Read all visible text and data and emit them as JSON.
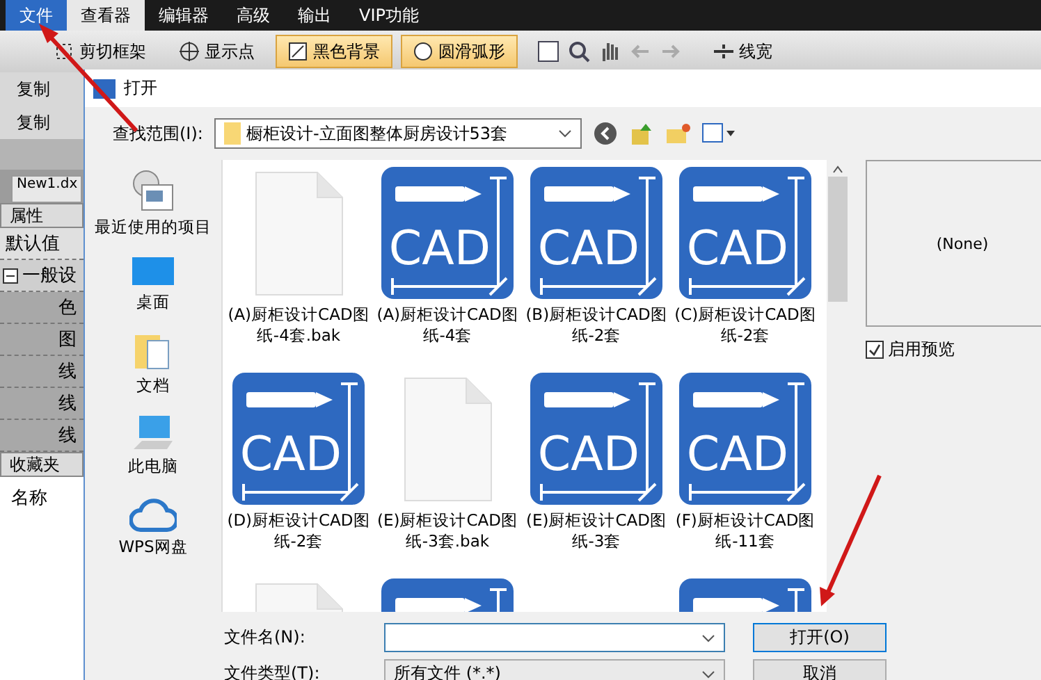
{
  "menu_tabs": [
    {
      "label": "文件",
      "kind": "file",
      "selected": false
    },
    {
      "label": "查看器",
      "kind": "tab",
      "selected": true
    },
    {
      "label": "编辑器",
      "kind": "tab",
      "selected": false
    },
    {
      "label": "高级",
      "kind": "tab",
      "selected": false
    },
    {
      "label": "输出",
      "kind": "tab",
      "selected": false
    },
    {
      "label": "VIP功能",
      "kind": "tab",
      "selected": false
    }
  ],
  "toolbar": [
    {
      "label": "剪切框架",
      "on": false
    },
    {
      "label": "显示点",
      "on": false
    },
    {
      "label": "黑色背景",
      "on": true
    },
    {
      "label": "圆滑弧形",
      "on": true
    },
    {
      "label": "线宽",
      "on": false
    }
  ],
  "left_panel": {
    "copy_buttons": [
      "复制",
      "复制"
    ],
    "doc_tab": "New1.dx",
    "properties_header": "属性",
    "default_row": "默认值",
    "group": {
      "label": "一般设",
      "expanded": true,
      "children": [
        "色",
        "图",
        "线",
        "线",
        "线"
      ]
    },
    "favorites_header": "收藏夹",
    "name_label": "名称"
  },
  "dialog": {
    "title": "打开",
    "look_in_label": "查找范围(I):",
    "look_in_value": "橱柜设计-立面图整体厨房设计53套",
    "places": [
      {
        "label": "最近使用的项目"
      },
      {
        "label": "桌面"
      },
      {
        "label": "文档"
      },
      {
        "label": "此电脑"
      },
      {
        "label": "WPS网盘"
      }
    ],
    "files": [
      {
        "kind": "blank",
        "label": "(A)厨柜设计CAD图纸-4套.bak"
      },
      {
        "kind": "cad",
        "icon_text": "CAD",
        "label": "(A)厨柜设计CAD图纸-4套"
      },
      {
        "kind": "cad",
        "icon_text": "CAD",
        "label": "(B)厨柜设计CAD图纸-2套"
      },
      {
        "kind": "cad",
        "icon_text": "CAD",
        "label": "(C)厨柜设计CAD图纸-2套"
      },
      {
        "kind": "cad",
        "icon_text": "CAD",
        "label": "(D)厨柜设计CAD图纸-2套"
      },
      {
        "kind": "blank",
        "label": "(E)厨柜设计CAD图纸-3套.bak"
      },
      {
        "kind": "cad",
        "icon_text": "CAD",
        "label": "(E)厨柜设计CAD图纸-3套"
      },
      {
        "kind": "cad",
        "icon_text": "CAD",
        "label": "(F)厨柜设计CAD图纸-11套"
      },
      {
        "kind": "blank"
      },
      {
        "kind": "cad"
      },
      {
        "kind": "none"
      },
      {
        "kind": "cad"
      }
    ],
    "preview_text": "(None)",
    "preview_checkbox": {
      "label": "启用预览",
      "checked": true
    },
    "filename_label": "文件名(N):",
    "filetype_label": "文件类型(T):",
    "filetype_value": "所有文件 (*.*)",
    "open_button": "打开(O)",
    "cancel_button": "取消"
  }
}
